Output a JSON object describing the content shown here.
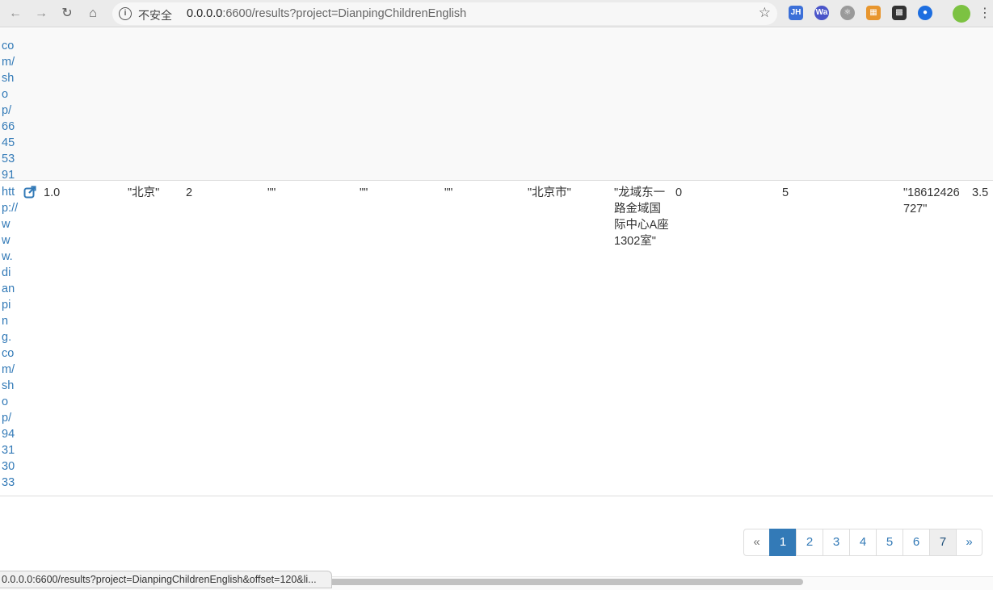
{
  "browser": {
    "security_label": "不安全",
    "url_host": "0.0.0.0",
    "url_rest": ":6600/results?project=DianpingChildrenEnglish",
    "extensions": [
      {
        "name": "jh-extension-icon",
        "label": "JH",
        "color": "#3b6fd8"
      },
      {
        "name": "wa-extension-icon",
        "label": "Wa",
        "color": "#4a55c9"
      },
      {
        "name": "react-devtools-icon",
        "label": "⚛",
        "color": "#9a9a9a"
      },
      {
        "name": "puzzle-extension-icon",
        "label": "▦",
        "color": "#e8962e"
      },
      {
        "name": "qr-code-icon",
        "label": "▩",
        "color": "#333333"
      },
      {
        "name": "globe-extension-icon",
        "label": "●",
        "color": "#1d6ee0"
      }
    ]
  },
  "table": {
    "row1": {
      "url_fragments": [
        "",
        "co",
        "m/",
        "sh",
        "o",
        "p/",
        "66",
        "45",
        "53",
        "91"
      ]
    },
    "row2": {
      "url_fragments": [
        "htt",
        "p://",
        "w",
        "w",
        "w.",
        "di",
        "an",
        "pi",
        "n",
        "g.",
        "co",
        "m/",
        "sh",
        "o",
        "p/",
        "94",
        "31",
        "30",
        "33"
      ],
      "score": "1.0",
      "city": "\"北京\"",
      "count": "2",
      "empty1": "\"\"",
      "empty2": "\"\"",
      "empty3": "\"\"",
      "region": "\"北京市\"",
      "address": "\"龙域东一路金域国际中心A座1302室\"",
      "zero": "0",
      "five": "5",
      "phone": "\"18612426727\"",
      "rating": "3.5"
    }
  },
  "pagination": {
    "prev": "«",
    "pages": [
      "1",
      "2",
      "3",
      "4",
      "5",
      "6",
      "7"
    ],
    "active_page": "1",
    "next": "»"
  },
  "status_bar": {
    "link_preview": "0.0.0.0:6600/results?project=DianpingChildrenEnglish&offset=120&li..."
  }
}
